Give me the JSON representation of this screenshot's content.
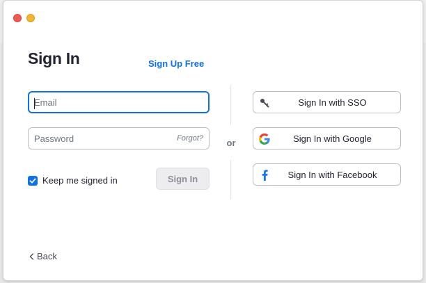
{
  "window": {
    "title": "Sign In",
    "signup_link": "Sign Up Free"
  },
  "form": {
    "email": {
      "value": "",
      "placeholder": "Email"
    },
    "password": {
      "value": "",
      "placeholder": "Password"
    },
    "forgot_link": "Forgot?",
    "keep_signed_in": {
      "label": "Keep me signed in",
      "checked": true
    },
    "signin_button": "Sign In"
  },
  "divider": {
    "or": "or"
  },
  "alternatives": [
    {
      "label": "Sign In with SSO",
      "icon": "key-icon"
    },
    {
      "label": "Sign In with Google",
      "icon": "google-icon"
    },
    {
      "label": "Sign In with Facebook",
      "icon": "facebook-icon"
    }
  ],
  "footer": {
    "back": "Back"
  },
  "colors": {
    "accent": "#0e71eb",
    "text": "#232333",
    "muted": "#6e7680",
    "close": "#ee5b54",
    "minimize": "#f3b531",
    "facebook": "#1877f2"
  }
}
